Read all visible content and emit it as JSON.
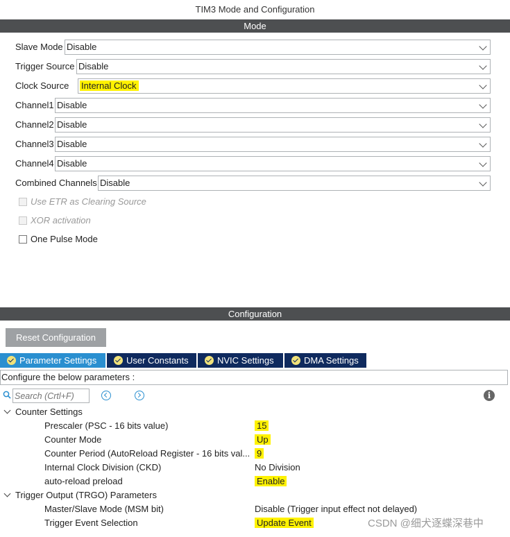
{
  "window": {
    "title": "TIM3 Mode and Configuration"
  },
  "mode": {
    "header": "Mode",
    "fields": [
      {
        "label": "Slave Mode",
        "value": "Disable"
      },
      {
        "label": "Trigger Source",
        "value": "Disable"
      },
      {
        "label": "Clock Source",
        "value": "Internal Clock"
      },
      {
        "label": "Channel1",
        "value": "Disable"
      },
      {
        "label": "Channel2",
        "value": "Disable"
      },
      {
        "label": "Channel3",
        "value": "Disable"
      },
      {
        "label": "Channel4",
        "value": "Disable"
      },
      {
        "label": "Combined Channels",
        "value": "Disable"
      }
    ],
    "checkboxes": [
      {
        "label": "Use ETR as Clearing Source",
        "enabled": false,
        "checked": false
      },
      {
        "label": "XOR activation",
        "enabled": false,
        "checked": false
      },
      {
        "label": "One Pulse Mode",
        "enabled": true,
        "checked": false
      }
    ]
  },
  "configuration": {
    "header": "Configuration",
    "reset_label": "Reset Configuration",
    "tabs": [
      {
        "label": "Parameter Settings",
        "icon": "check-circle-icon",
        "active": true
      },
      {
        "label": "User Constants",
        "icon": "check-circle-icon",
        "active": false
      },
      {
        "label": "NVIC Settings",
        "icon": "check-circle-icon",
        "active": false
      },
      {
        "label": "DMA Settings",
        "icon": "check-circle-icon",
        "active": false
      }
    ],
    "configure_text": "Configure the below parameters :",
    "search_placeholder": "Search (Crtl+F)",
    "groups": [
      {
        "name": "Counter Settings",
        "params": [
          {
            "name": "Prescaler (PSC - 16 bits value)",
            "value": "15"
          },
          {
            "name": "Counter Mode",
            "value": "Up"
          },
          {
            "name": "Counter Period (AutoReload Register - 16 bits val...",
            "value": "9"
          },
          {
            "name": "Internal Clock Division (CKD)",
            "value": "No Division"
          },
          {
            "name": "auto-reload preload",
            "value": "Enable"
          }
        ]
      },
      {
        "name": "Trigger Output (TRGO) Parameters",
        "params": [
          {
            "name": "Master/Slave Mode (MSM bit)",
            "value": "Disable (Trigger input effect not delayed)"
          },
          {
            "name": "Trigger Event Selection",
            "value": "Update Event"
          }
        ]
      }
    ]
  },
  "watermark": "CSDN @细犬逐蝶深巷中",
  "colors": {
    "header_bar": "#4d4f51",
    "tab_active": "#2a8fd0",
    "tab_inactive": "#0f2a5e",
    "highlight": "#fff200",
    "reset_button": "#9ea1a4"
  }
}
